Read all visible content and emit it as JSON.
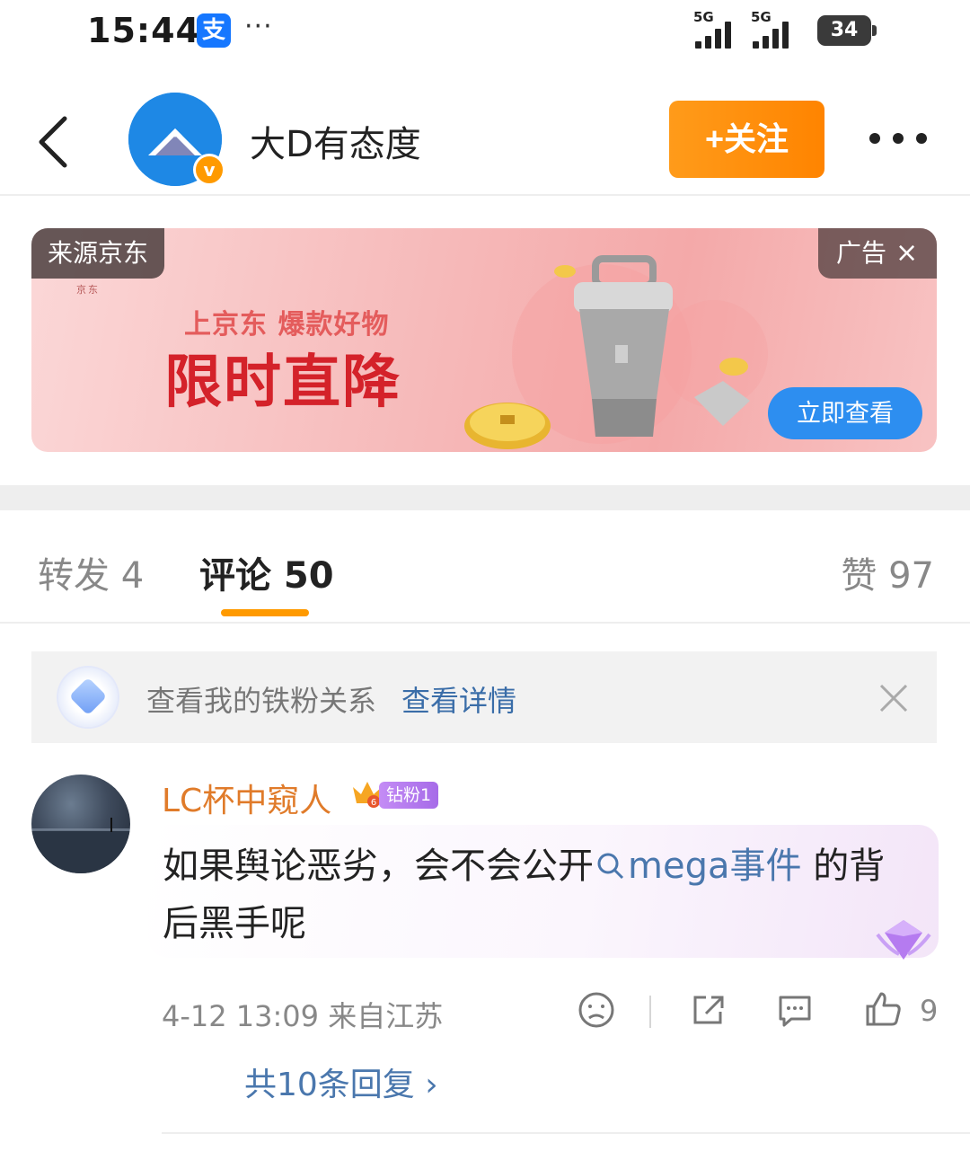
{
  "status_bar": {
    "time": "15:44",
    "app_icon": "支",
    "dots": "···",
    "network_1": "5G",
    "network_2": "5G",
    "battery": "34"
  },
  "header": {
    "account_name": "大D有态度",
    "verified_icon": "v",
    "follow_label": "+关注",
    "icons": [
      "back-icon",
      "more-icon"
    ]
  },
  "ad": {
    "source_tag": "来源京东",
    "label": "广告",
    "close_glyph": "×",
    "brand_small": "京东",
    "subtitle": "上京东  爆款好物",
    "title": "限时直降",
    "cta_label": "立即查看"
  },
  "tabs": {
    "repost": "转发 4",
    "comments": "评论 50",
    "likes": "赞 97",
    "active": "comments",
    "accent_color": "#ff9a00"
  },
  "fan_banner": {
    "text": "查看我的铁粉关系",
    "link": "查看详情"
  },
  "comment": {
    "username": "LC杯中窥人",
    "crown_level": "6",
    "fan_badge": "钻粉1",
    "text_before": "如果舆论恶劣，会不会公开",
    "topic": "mega事件",
    "text_after": " 的背后黑手呢",
    "timestamp": "4-12 13:09",
    "location": "来自江苏",
    "like_count": "9",
    "replies_link": "共10条回复 ›"
  }
}
